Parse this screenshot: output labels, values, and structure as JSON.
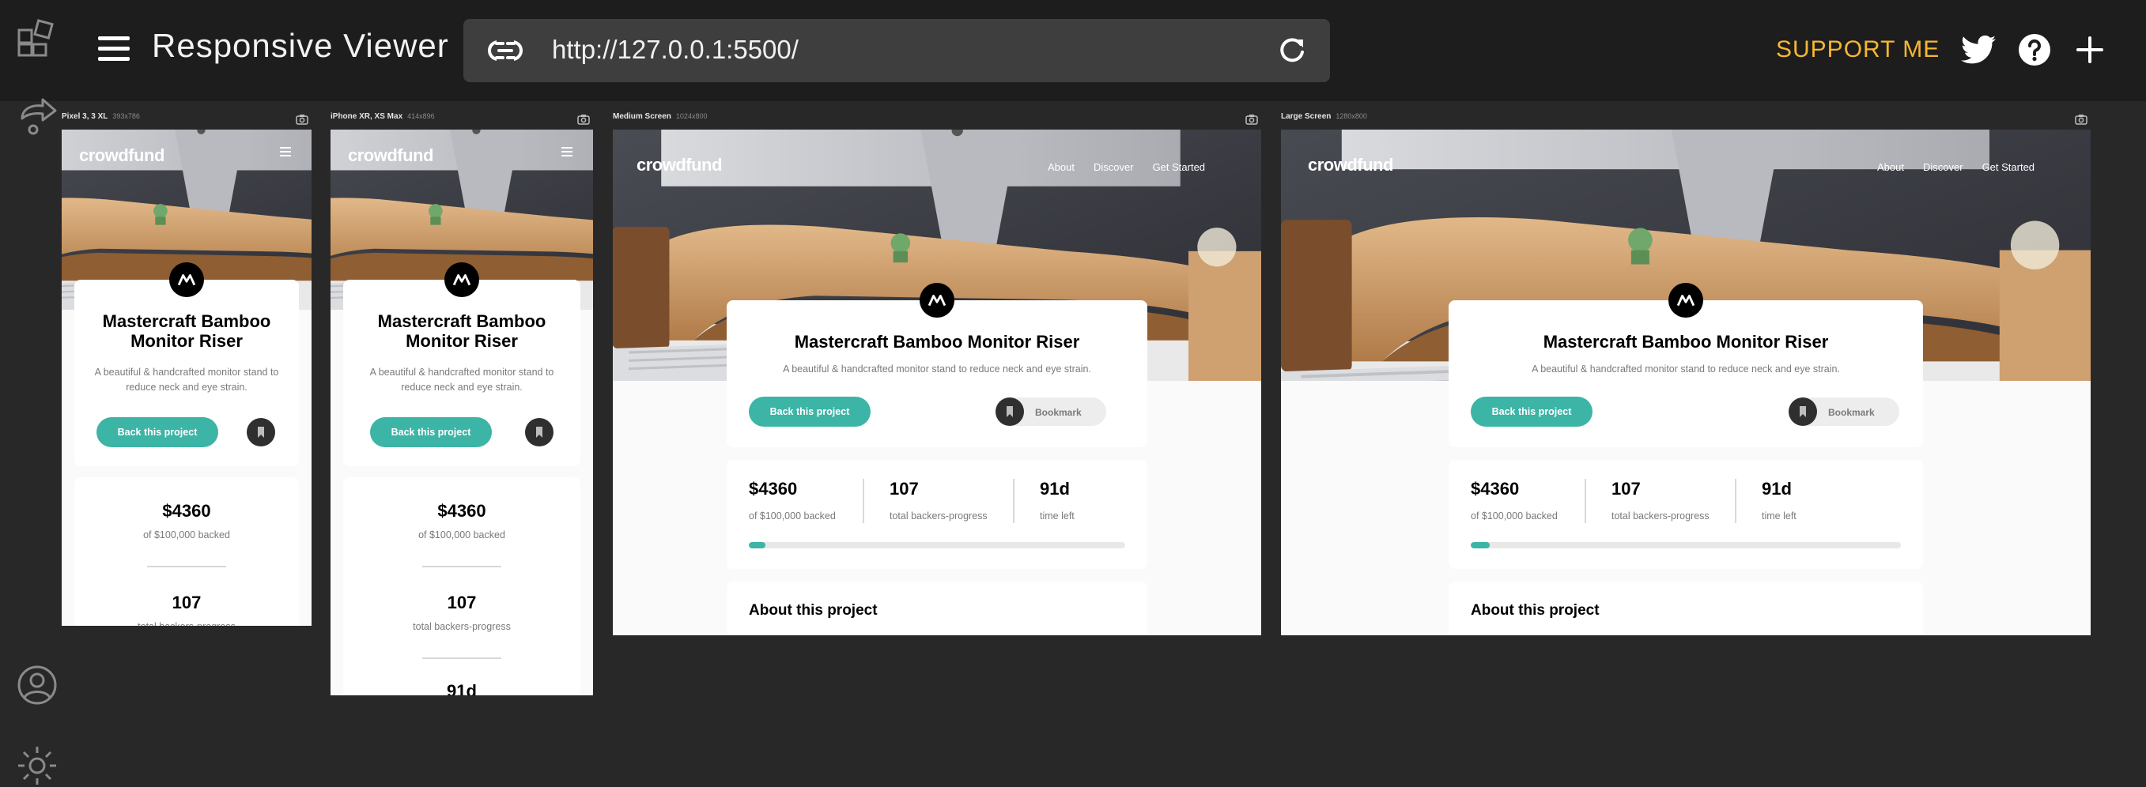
{
  "app": {
    "title": "Responsive Viewer",
    "url": "http://127.0.0.1:5500/",
    "support_label": "SUPPORT ME",
    "accent_color": "#f5b731"
  },
  "sidebar": {
    "icons": [
      "layout-icon",
      "share-icon",
      "user-icon",
      "settings-icon"
    ]
  },
  "devices": [
    {
      "name": "Pixel 3, 3 XL",
      "size": "393x786"
    },
    {
      "name": "iPhone XR, XS Max",
      "size": "414x896"
    },
    {
      "name": "Medium Screen",
      "size": "1024x800"
    },
    {
      "name": "Large Screen",
      "size": "1280x800"
    }
  ],
  "site": {
    "logo": "crowdfund",
    "nav": [
      "About",
      "Discover",
      "Get Started"
    ],
    "project_title": "Mastercraft Bamboo Monitor Riser",
    "project_desc": "A beautiful & handcrafted monitor stand to reduce neck and eye strain.",
    "back_label": "Back this project",
    "bookmark_label": "Bookmark",
    "stats": [
      {
        "value": "$4360",
        "label": "of $100,000 backed"
      },
      {
        "value": "107",
        "label": "total backers-progress"
      },
      {
        "value": "91d",
        "label": "time left"
      }
    ],
    "progress_fraction": 0.044,
    "about_title": "About this project",
    "brand_color": "#3cb4a6"
  }
}
